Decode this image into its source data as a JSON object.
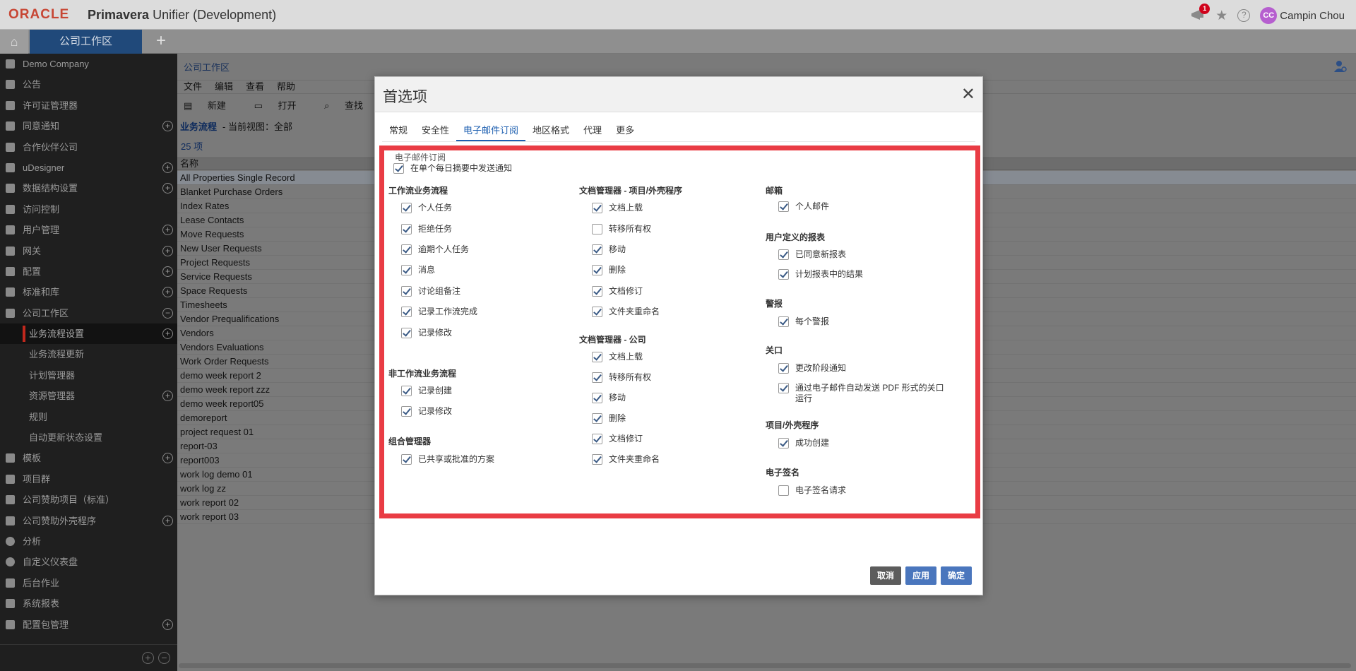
{
  "header": {
    "oracle": "ORACLE",
    "product_bold": "Primavera",
    "product_rest": "Unifier  (Development)",
    "notification_count": "1",
    "avatar_initials": "CC",
    "user_name": "Campin Chou"
  },
  "tabbar": {
    "workspace_tab": "公司工作区",
    "add": "+"
  },
  "sidebar": {
    "items": [
      {
        "label": "Demo Company",
        "plus": false
      },
      {
        "label": "公告",
        "plus": false
      },
      {
        "label": "许可证管理器",
        "plus": false
      },
      {
        "label": "同意通知",
        "plus": true
      },
      {
        "label": "合作伙伴公司",
        "plus": false
      },
      {
        "label": "uDesigner",
        "plus": true
      },
      {
        "label": "数据结构设置",
        "plus": true
      },
      {
        "label": "访问控制",
        "plus": false
      },
      {
        "label": "用户管理",
        "plus": true
      },
      {
        "label": "网关",
        "plus": true
      },
      {
        "label": "配置",
        "plus": true
      },
      {
        "label": "标准和库",
        "plus": true
      },
      {
        "label": "公司工作区",
        "plus": false,
        "minus": true
      },
      {
        "label": "业务流程设置",
        "plus": true,
        "sub": true,
        "active": true
      },
      {
        "label": "业务流程更新",
        "plus": false,
        "sub": true
      },
      {
        "label": "计划管理器",
        "plus": false,
        "sub": true
      },
      {
        "label": "资源管理器",
        "plus": true,
        "sub": true
      },
      {
        "label": "规则",
        "plus": false,
        "sub": true
      },
      {
        "label": "自动更新状态设置",
        "plus": false,
        "sub": true
      },
      {
        "label": "模板",
        "plus": true
      },
      {
        "label": "项目群",
        "plus": false
      },
      {
        "label": "公司赞助项目（标准）",
        "plus": false
      },
      {
        "label": "公司赞助外壳程序",
        "plus": true
      },
      {
        "label": "分析",
        "plus": false
      },
      {
        "label": "自定义仪表盘",
        "plus": false
      },
      {
        "label": "后台作业",
        "plus": false
      },
      {
        "label": "系统报表",
        "plus": false
      },
      {
        "label": "配置包管理",
        "plus": true
      }
    ]
  },
  "main": {
    "title": "公司工作区",
    "menu": [
      "文件",
      "编辑",
      "查看",
      "帮助"
    ],
    "toolbar": [
      "新建",
      "打开",
      "查找"
    ],
    "view_label": "业务流程",
    "view_current": "- 当前视图：全部",
    "count": "25  项",
    "column_name": "名称",
    "rows": [
      "All Properties Single Record",
      "Blanket Purchase Orders",
      "Index Rates",
      "Lease Contacts",
      "Move Requests",
      "New User Requests",
      "Project Requests",
      "Service Requests",
      "Space Requests",
      "Timesheets",
      "Vendor Prequalifications",
      "Vendors",
      "Vendors Evaluations",
      "Work Order Requests",
      "demo week report 2",
      "demo week report zzz",
      "demo week report05",
      "demoreport",
      "project request 01",
      "report-03",
      "report003",
      "work log demo 01",
      "work log zz",
      "work report 02",
      "work report 03"
    ]
  },
  "modal": {
    "title": "首选项",
    "close": "✕",
    "tabs": [
      "常规",
      "安全性",
      "电子邮件订阅",
      "地区格式",
      "代理",
      "更多"
    ],
    "active_tab": 2,
    "legend": "电子邮件订阅",
    "daily_digest": "在单个每日摘要中发送通知",
    "col1": {
      "g1": "工作流业务流程",
      "g1_items": [
        "个人任务",
        "拒绝任务",
        "逾期个人任务",
        "消息",
        "讨论组备注",
        "记录工作流完成",
        "记录修改"
      ],
      "g2": "非工作流业务流程",
      "g2_items": [
        "记录创建",
        "记录修改"
      ],
      "g3": "组合管理器",
      "g3_items": [
        "已共享或批准的方案"
      ]
    },
    "col2": {
      "g1": "文档管理器 - 项目/外壳程序",
      "g1_items": [
        "文档上载",
        "转移所有权",
        "移动",
        "删除",
        "文档修订",
        "文件夹重命名"
      ],
      "g2": "文档管理器 - 公司",
      "g2_items": [
        "文档上载",
        "转移所有权",
        "移动",
        "删除",
        "文档修订",
        "文件夹重命名"
      ]
    },
    "col3": {
      "g1": "邮箱",
      "g1_items": [
        "个人邮件"
      ],
      "g2": "用户定义的报表",
      "g2_items": [
        "已同意新报表",
        "计划报表中的结果"
      ],
      "g3": "警报",
      "g3_items": [
        "每个警报"
      ],
      "g4": "关口",
      "g4_items": [
        "更改阶段通知",
        "通过电子邮件自动发送 PDF 形式的关口运行"
      ],
      "g5": "项目/外壳程序",
      "g5_items": [
        "成功创建"
      ],
      "g6": "电子签名",
      "g6_items": [
        "电子签名请求"
      ]
    },
    "buttons": {
      "cancel": "取消",
      "apply": "应用",
      "ok": "确定"
    }
  },
  "colors": {
    "accent": "#1d5fb0",
    "highlight": "#e93c44",
    "oracle_red": "#c74634",
    "tab_active": "#20497a"
  }
}
